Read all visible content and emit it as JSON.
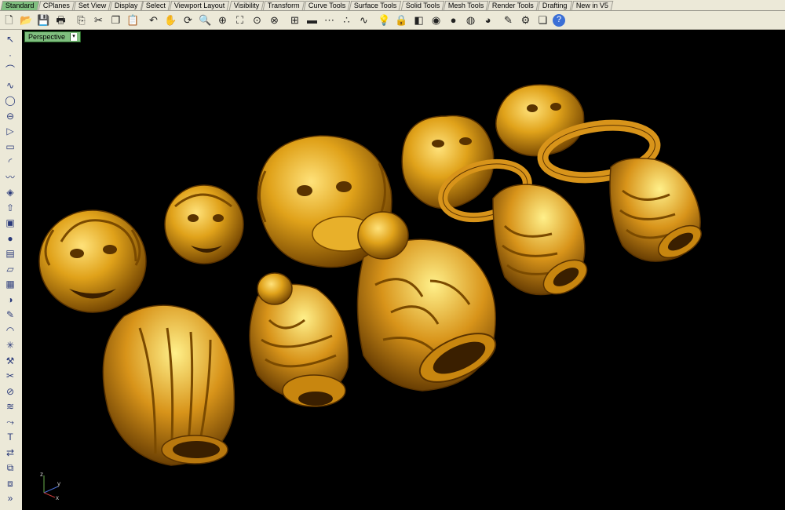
{
  "tabs": [
    {
      "label": "Standard",
      "active": true
    },
    {
      "label": "CPlanes"
    },
    {
      "label": "Set View"
    },
    {
      "label": "Display"
    },
    {
      "label": "Select"
    },
    {
      "label": "Viewport Layout"
    },
    {
      "label": "Visibility"
    },
    {
      "label": "Transform"
    },
    {
      "label": "Curve Tools"
    },
    {
      "label": "Surface Tools"
    },
    {
      "label": "Solid Tools"
    },
    {
      "label": "Mesh Tools"
    },
    {
      "label": "Render Tools"
    },
    {
      "label": "Drafting"
    },
    {
      "label": "New in V5"
    }
  ],
  "toolbar_icons": [
    "new-icon",
    "open-icon",
    "save-icon",
    "print-icon",
    "import-icon",
    "cut-icon",
    "copy-icon",
    "paste-icon",
    "undo-icon",
    "pan-hand-icon",
    "rotate-view-icon",
    "zoom-icon",
    "zoom-window-icon",
    "zoom-extents-icon",
    "zoom-selected-icon",
    "zoom-all-icon",
    "four-viewports-icon",
    "cplane-icon",
    "grid-snap-icon",
    "points-icon",
    "curves-icon",
    "light-icon",
    "lock-icon",
    "shade-icon",
    "color-wheel-icon",
    "render-icon",
    "sphere-gray-icon",
    "sphere-blue-icon",
    "options-icon",
    "gear-icon",
    "layer-icon",
    "help-icon"
  ],
  "left_toolbar_icons": [
    "select-arrow-icon",
    "point-icon",
    "polyline-icon",
    "curve-icon",
    "circle-icon",
    "ellipse-icon",
    "polygon-icon",
    "rectangle-icon",
    "arc-icon",
    "freeform-icon",
    "surface-icon",
    "extrude-icon",
    "box-icon",
    "sphere-icon",
    "cylinder-icon",
    "plane-icon",
    "mesh-icon",
    "boolean-icon",
    "edit-icon",
    "fillet-icon",
    "explode-icon",
    "join-icon",
    "trim-icon",
    "split-icon",
    "offset-icon",
    "project-icon",
    "text-icon",
    "transform-icon",
    "group-icon",
    "array-icon",
    "more-icon"
  ],
  "viewport": {
    "title": "Perspective"
  },
  "axes": {
    "x": "x",
    "y": "y",
    "z": "z"
  },
  "colors": {
    "viewport_bg": "#000000",
    "gold": "#e0a21a",
    "gold_dark": "#7a4a00",
    "gold_light": "#ffe27a",
    "active_tab": "#7fbf7f"
  }
}
